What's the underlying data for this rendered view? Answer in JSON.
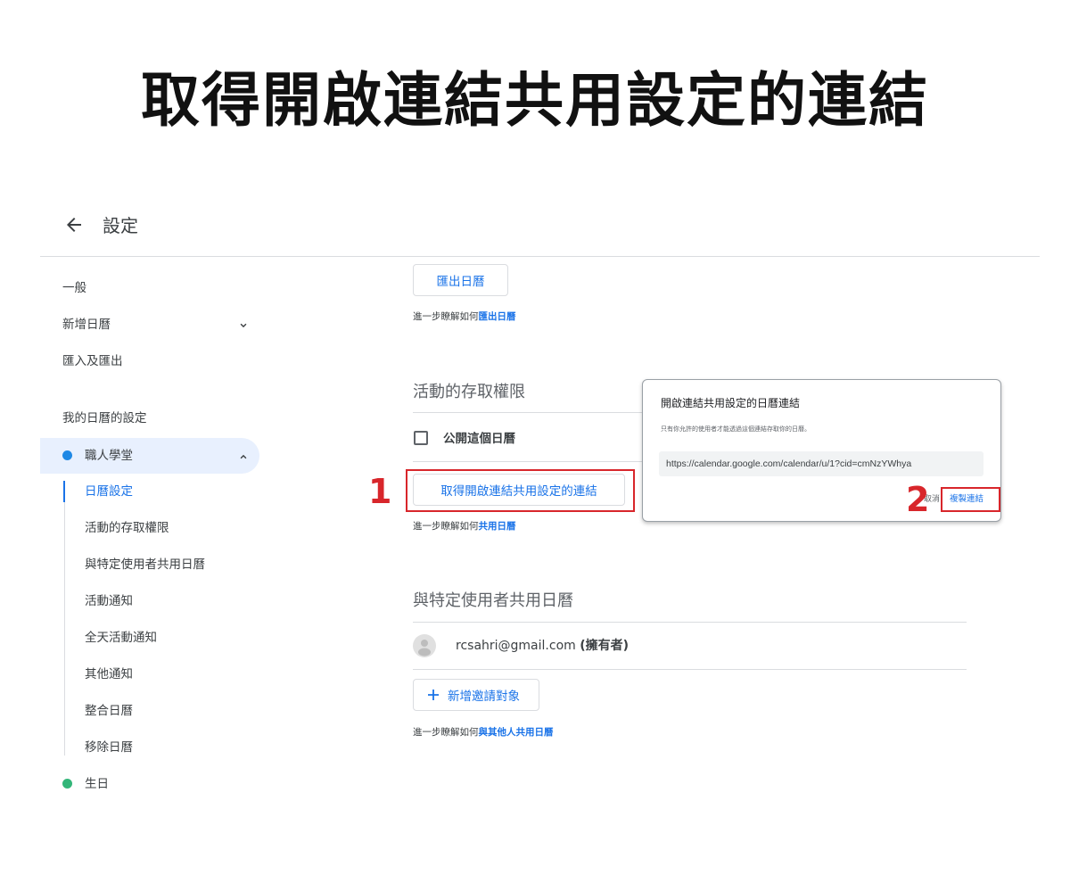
{
  "banner": {
    "title": "取得開啟連結共用設定的連結"
  },
  "header": {
    "title": "設定"
  },
  "sidebar": {
    "general": "一般",
    "add_calendar": "新增日曆",
    "import_export": "匯入及匯出",
    "my_calendars_heading": "我的日曆的設定",
    "calendar_name": "職人學堂",
    "sub_items": [
      "日曆設定",
      "活動的存取權限",
      "與特定使用者共用日曆",
      "活動通知",
      "全天活動通知",
      "其他通知",
      "整合日曆",
      "移除日曆"
    ],
    "birthday": "生日"
  },
  "export": {
    "button": "匯出日曆",
    "help_prefix": "進一步瞭解如何",
    "help_link": "匯出日曆"
  },
  "access": {
    "title": "活動的存取權限",
    "public_label": "公開這個日曆",
    "get_link_button": "取得開啟連結共用設定的連結",
    "help_prefix": "進一步瞭解如何",
    "help_link": "共用日曆"
  },
  "share": {
    "title": "與特定使用者共用日曆",
    "owner_email": "rcsahri@gmail.com",
    "owner_role": "(擁有者)",
    "add_button": "新增邀請對象",
    "help_prefix": "進一步瞭解如何",
    "help_link": "與其他人共用日曆"
  },
  "dialog": {
    "title": "開啟連結共用設定的日曆連結",
    "description": "只有你允許的使用者才能透過這個連結存取你的日曆。",
    "url": "https://calendar.google.com/calendar/u/1?cid=cmNzYWhya",
    "cancel": "取消",
    "copy": "複製連結"
  },
  "annotations": {
    "step1": "1",
    "step2": "2"
  },
  "colors": {
    "accent": "#1a73e8",
    "calendar_dot": "#1e88e5",
    "birthday_dot": "#33b679",
    "annotation": "#d8262b"
  }
}
